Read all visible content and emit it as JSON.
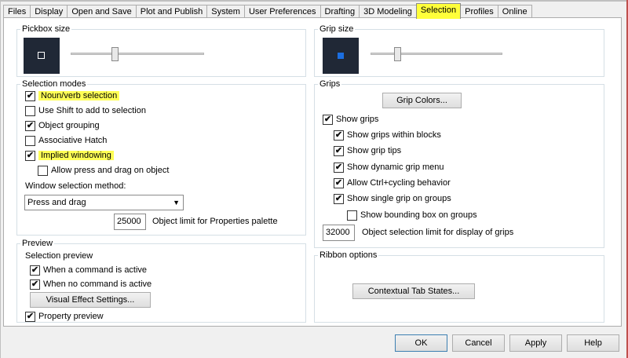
{
  "tabs": [
    "Files",
    "Display",
    "Open and Save",
    "Plot and Publish",
    "System",
    "User Preferences",
    "Drafting",
    "3D Modeling",
    "Selection",
    "Profiles",
    "Online"
  ],
  "active_tab": "Selection",
  "pickbox": {
    "title": "Pickbox size",
    "slider_level": 0.33
  },
  "grip_size": {
    "title": "Grip size",
    "slider_level": 0.2
  },
  "selection_modes": {
    "title": "Selection modes",
    "noun_verb": {
      "label": "Noun/verb selection",
      "checked": true
    },
    "use_shift": {
      "label": "Use Shift to add to selection",
      "checked": false
    },
    "object_grouping": {
      "label": "Object grouping",
      "checked": true
    },
    "associative_hatch": {
      "label": "Associative Hatch",
      "checked": false
    },
    "implied_windowing": {
      "label": "Implied windowing",
      "checked": true
    },
    "allow_press_drag": {
      "label": "Allow press and drag on object",
      "checked": false
    },
    "window_method_label": "Window selection method:",
    "window_method_value": "Press and drag",
    "object_limit_value": "25000",
    "object_limit_label": "Object limit for Properties palette"
  },
  "preview": {
    "title": "Preview",
    "selection_preview_label": "Selection preview",
    "when_active": {
      "label": "When a command is active",
      "checked": true
    },
    "when_no_command": {
      "label": "When no command is active",
      "checked": true
    },
    "visual_effect_button": "Visual Effect Settings...",
    "property_preview": {
      "label": "Property preview",
      "checked": true
    }
  },
  "grips": {
    "title": "Grips",
    "grip_colors_button": "Grip Colors...",
    "show_grips": {
      "label": "Show grips",
      "checked": true
    },
    "within_blocks": {
      "label": "Show grips within blocks",
      "checked": true
    },
    "grip_tips": {
      "label": "Show grip tips",
      "checked": true
    },
    "dynamic_menu": {
      "label": "Show dynamic grip menu",
      "checked": true
    },
    "ctrl_cycling": {
      "label": "Allow Ctrl+cycling behavior",
      "checked": true
    },
    "single_grip": {
      "label": "Show single grip on groups",
      "checked": true
    },
    "bounding_box": {
      "label": "Show bounding box on groups",
      "checked": false
    },
    "limit_value": "32000",
    "limit_label": "Object selection limit for display of grips"
  },
  "ribbon": {
    "title": "Ribbon options",
    "contextual_button": "Contextual Tab States..."
  },
  "footer": {
    "ok": "OK",
    "cancel": "Cancel",
    "apply": "Apply",
    "help": "Help"
  },
  "colors": {
    "highlight": "#ffff55",
    "grip_blue": "#1b6ee0",
    "preview_bg": "#202836"
  },
  "check_mark": "✔"
}
